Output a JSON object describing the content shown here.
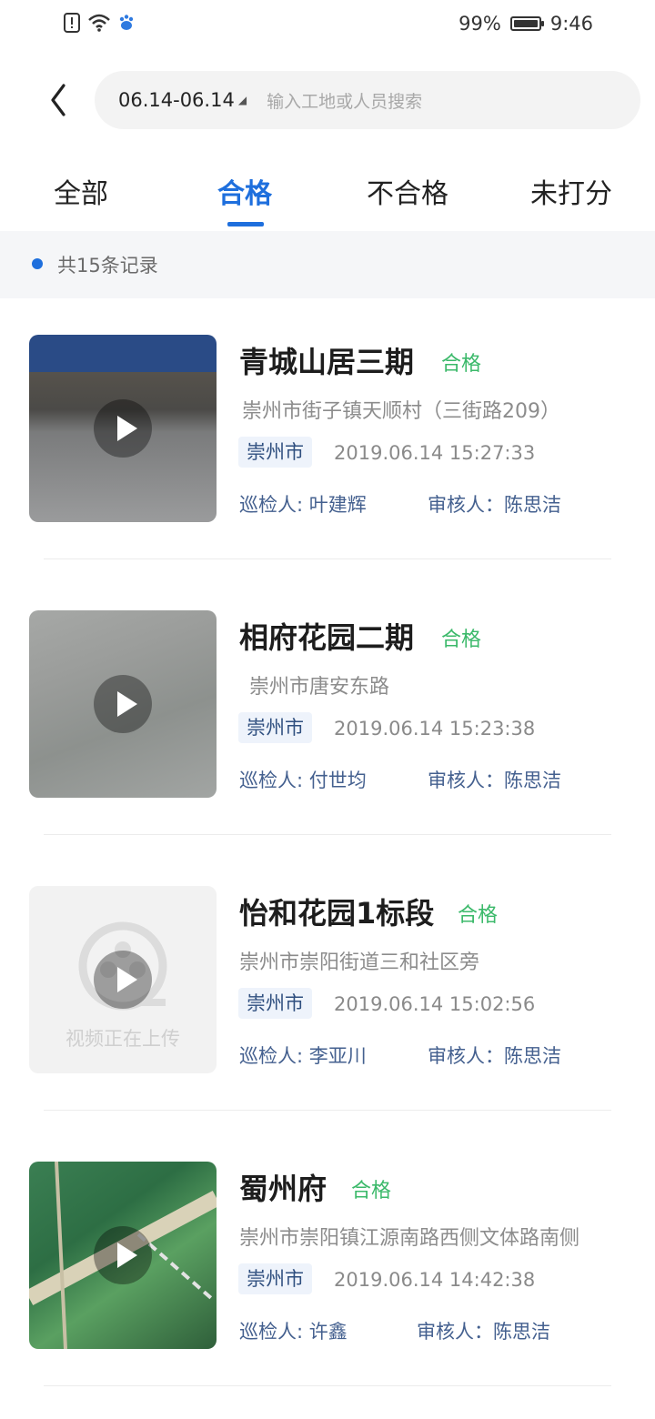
{
  "status_bar": {
    "battery": "99%",
    "time": "9:46",
    "icons": [
      "alert-icon",
      "wifi-icon",
      "paw-icon"
    ]
  },
  "header": {
    "date_range": "06.14-06.14",
    "search_placeholder": "输入工地或人员搜索"
  },
  "tabs": [
    {
      "label": "全部",
      "active": false
    },
    {
      "label": "合格",
      "active": true
    },
    {
      "label": "不合格",
      "active": false
    },
    {
      "label": "未打分",
      "active": false
    }
  ],
  "summary": {
    "text": "共15条记录"
  },
  "records": [
    {
      "title": "青城山居三期",
      "status": "合格",
      "address": "崇州市街子镇天顺村（三街路209）",
      "region": "崇州市",
      "datetime": "2019.06.14 15:27:33",
      "inspector": "巡检人: 叶建辉",
      "reviewer": "审核人：陈思洁"
    },
    {
      "title": "相府花园二期",
      "status": "合格",
      "address": "崇州市唐安东路",
      "region": "崇州市",
      "datetime": "2019.06.14 15:23:38",
      "inspector": "巡检人: 付世均",
      "reviewer": "审核人：陈思洁"
    },
    {
      "title": "怡和花园1标段",
      "status": "合格",
      "address": "崇州市崇阳街道三和社区旁",
      "region": "崇州市",
      "datetime": "2019.06.14 15:02:56",
      "inspector": "巡检人: 李亚川",
      "reviewer": "审核人：陈思洁",
      "thumb_text": "视频正在上传"
    },
    {
      "title": "蜀州府",
      "status": "合格",
      "address": "崇州市崇阳镇江源南路西侧文体路南侧",
      "region": "崇州市",
      "datetime": "2019.06.14 14:42:38",
      "inspector": "巡检人: 许鑫",
      "reviewer": "审核人：陈思洁"
    }
  ],
  "colors": {
    "accent": "#1e6fdd",
    "pass": "#3bb96a",
    "tag_bg": "#eef3fb"
  }
}
